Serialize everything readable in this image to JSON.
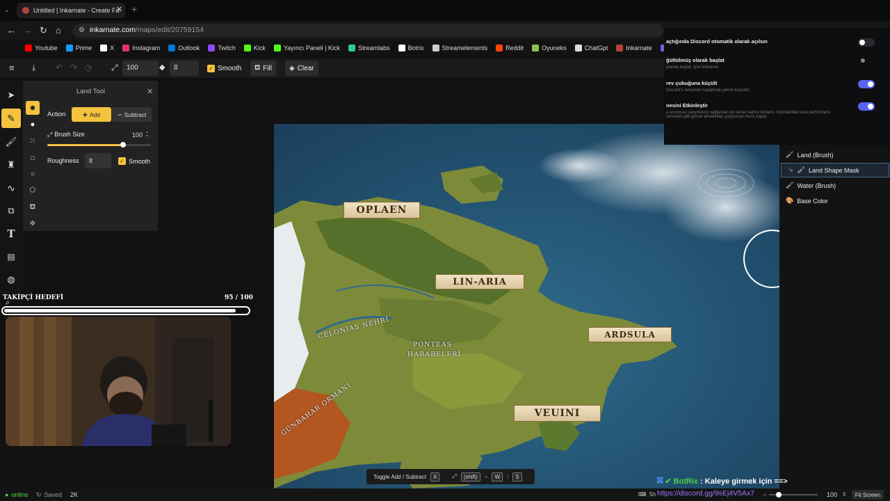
{
  "browser": {
    "tab_title": "Untitled | Inkarnate - Create Fa",
    "url_host": "inkarnate.com",
    "url_path": "/maps/edit/20759154",
    "bookmarks": [
      {
        "label": "Youtube",
        "color": "#ff0000"
      },
      {
        "label": "Prime",
        "color": "#1a98ff"
      },
      {
        "label": "X",
        "color": "#ffffff"
      },
      {
        "label": "Instagram",
        "color": "#e1306c"
      },
      {
        "label": "Outlook",
        "color": "#0078d4"
      },
      {
        "label": "Twitch",
        "color": "#9146ff"
      },
      {
        "label": "Kick",
        "color": "#53fc18"
      },
      {
        "label": "Yayıncı Paneli | Kick",
        "color": "#53fc18"
      },
      {
        "label": "Streamlabs",
        "color": "#31c3a2"
      },
      {
        "label": "Botrix",
        "color": "#ffffff"
      },
      {
        "label": "Streamelements",
        "color": "#cccccc"
      },
      {
        "label": "Reddit",
        "color": "#ff4500"
      },
      {
        "label": "Oyuneks",
        "color": "#8bc34a"
      },
      {
        "label": "ChatGpt",
        "color": "#dddddd"
      },
      {
        "label": "Inkarnate",
        "color": "#b2453a"
      },
      {
        "label": "Excalidraw",
        "color": "#6965db"
      }
    ]
  },
  "toolbar": {
    "size_value": "100",
    "roughness_value": "8",
    "smooth_label": "Smooth",
    "fill_label": "Fill",
    "clear_label": "Clear"
  },
  "land_tool": {
    "title": "Land Tool",
    "action_label": "Action",
    "add_label": "Add",
    "subtract_label": "Subtract",
    "brush_size_label": "Brush Size",
    "brush_size_value": "100",
    "brush_size_fraction": 0.73,
    "roughness_label": "Roughness",
    "roughness_value": "8",
    "smooth_label": "Smooth"
  },
  "follower_goal": {
    "label": "TAKİPÇİ HEDEFİ",
    "count": "95 / 100",
    "fraction": 0.95
  },
  "map_labels": {
    "oplaen": "OPLAEN",
    "linaria": "LIN-ARIA",
    "ardsula": "ARDSULA",
    "veuini": "VEUINI",
    "celonias": "CELONIAS NEHRİ",
    "ponteas1": "PONTEAS",
    "ponteas2": "HARABELERİ",
    "gunbahar": "GÜNBAHAR ORMANI"
  },
  "discord_overlay": {
    "items": [
      {
        "title": "açtığında Discord otomatik olarak açılsın",
        "desc": "",
        "on": false
      },
      {
        "title": "ğültülmüş olarak başlat",
        "desc": "planda başlat, işini bölmesin.",
        "on": false
      },
      {
        "title": "rev çubuğuna küçült",
        "desc": "Discord'u tamamen kapatmak yerine küçültür.",
        "on": true
      },
      {
        "title": "nesini Etkinleştir",
        "desc": "a sorunsuz çalışmasını sağlamak için ekran kartını kullanır. Oyunlardaki kare performans sorunları gibi görsel aksaklıklar yaşıyorsan bunu kapat.",
        "on": true
      }
    ]
  },
  "layers": [
    {
      "label": "Land (Brush)"
    },
    {
      "label": "Land Shape Mask"
    },
    {
      "label": "Water (Brush)"
    },
    {
      "label": "Base Color"
    }
  ],
  "hint_bar": {
    "label": "Toggle Add / Subtract",
    "key_x": "X",
    "key_shift": "(shift)",
    "key_w": "W",
    "key_s": "S"
  },
  "chat": {
    "user": "BotRix",
    "message": ": Kaleye girmek için ==>",
    "link": "https://discord.gg/9sEj4V5Ax7"
  },
  "status": {
    "online_label": "online",
    "saved_label": "Saved",
    "size_label": "2K",
    "shortcuts_label": "Sh",
    "zoom_value": "100",
    "fit_screen_label": "Fit Screen"
  },
  "colors": {
    "accent": "#f5c23e",
    "discord_toggle": "#5865f2",
    "botrix_green": "#4ad34a",
    "link_purple": "#9b7bff"
  }
}
